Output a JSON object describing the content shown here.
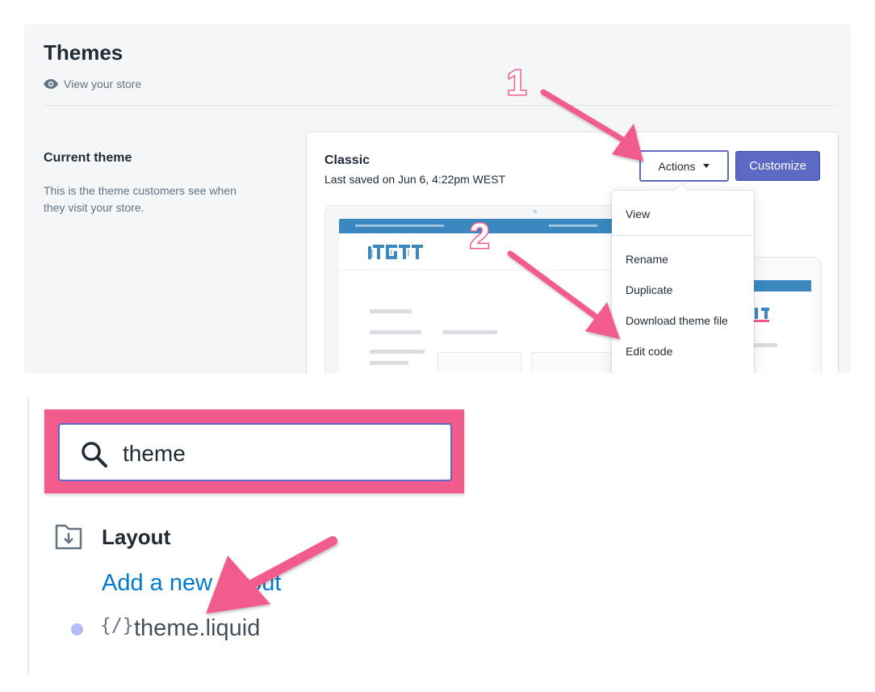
{
  "themes_page": {
    "title": "Themes",
    "view_store": "View your store",
    "current_theme": {
      "heading": "Current theme",
      "description": "This is the theme customers see when they visit your store.",
      "theme_name": "Classic",
      "last_saved": "Last saved on Jun 6, 4:22pm WEST",
      "actions_label": "Actions",
      "customize_label": "Customize"
    },
    "actions_menu": {
      "items": [
        "View",
        "Rename",
        "Duplicate",
        "Download theme file",
        "Edit code"
      ]
    }
  },
  "annotations": {
    "step_1": "1",
    "step_2": "2",
    "arrow_color": "#f25c8c"
  },
  "code_editor": {
    "search": {
      "value": "theme"
    },
    "folder": {
      "label": "Layout",
      "add_link": "Add a new layout"
    },
    "file": {
      "name": "theme.liquid",
      "icon": "{/}"
    }
  },
  "colors": {
    "primary": "#5c6ac4",
    "link": "#007ace",
    "highlight": "#f25c8c",
    "preview_header": "#3a88bf"
  }
}
